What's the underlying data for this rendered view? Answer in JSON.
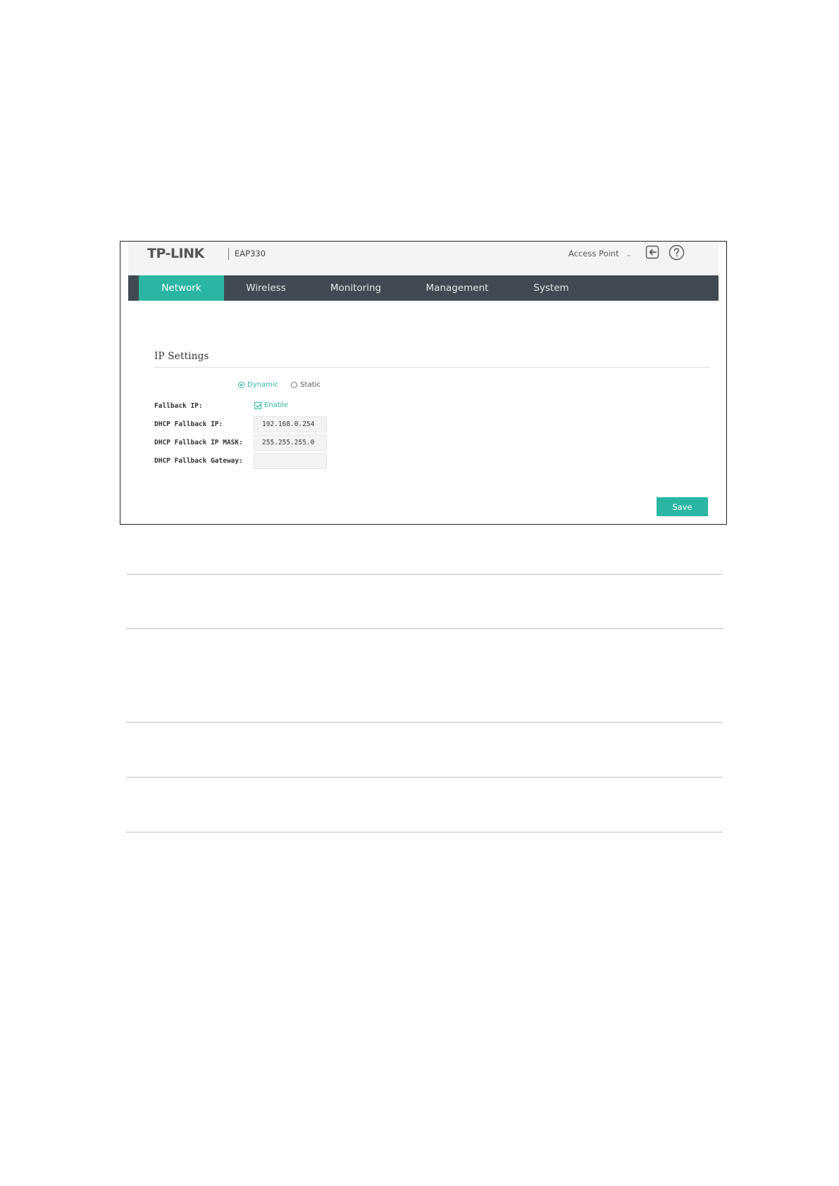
{
  "header": {
    "logo": "TP-LINK",
    "model": "EAP330",
    "mode_select": "Access Point",
    "icons": [
      "logout-icon",
      "help-icon",
      "chevron-down-icon"
    ]
  },
  "nav": {
    "items": [
      {
        "label": "Network",
        "active": true
      },
      {
        "label": "Wireless",
        "active": false
      },
      {
        "label": "Monitoring",
        "active": false
      },
      {
        "label": "Management",
        "active": false
      },
      {
        "label": "System",
        "active": false
      }
    ]
  },
  "ip_settings": {
    "title": "IP Settings",
    "mode_options": [
      {
        "label": "Dynamic",
        "selected": true
      },
      {
        "label": "Static",
        "selected": false
      }
    ],
    "fallback_ip_label": "Fallback IP:",
    "fallback_ip_enable_label": "Enable",
    "fallback_ip_enabled": true,
    "dhcp_fallback_ip_label": "DHCP Fallback IP:",
    "dhcp_fallback_ip_value": "192.168.0.254",
    "dhcp_fallback_mask_label": "DHCP Fallback IP MASK:",
    "dhcp_fallback_mask_value": "255.255.255.0",
    "dhcp_fallback_gateway_label": "DHCP Fallback Gateway:",
    "dhcp_fallback_gateway_value": "",
    "save_label": "Save"
  },
  "colors": {
    "accent": "#2bb6a3",
    "nav_background": "#414a52",
    "topbar_background": "#f4f4f4"
  }
}
